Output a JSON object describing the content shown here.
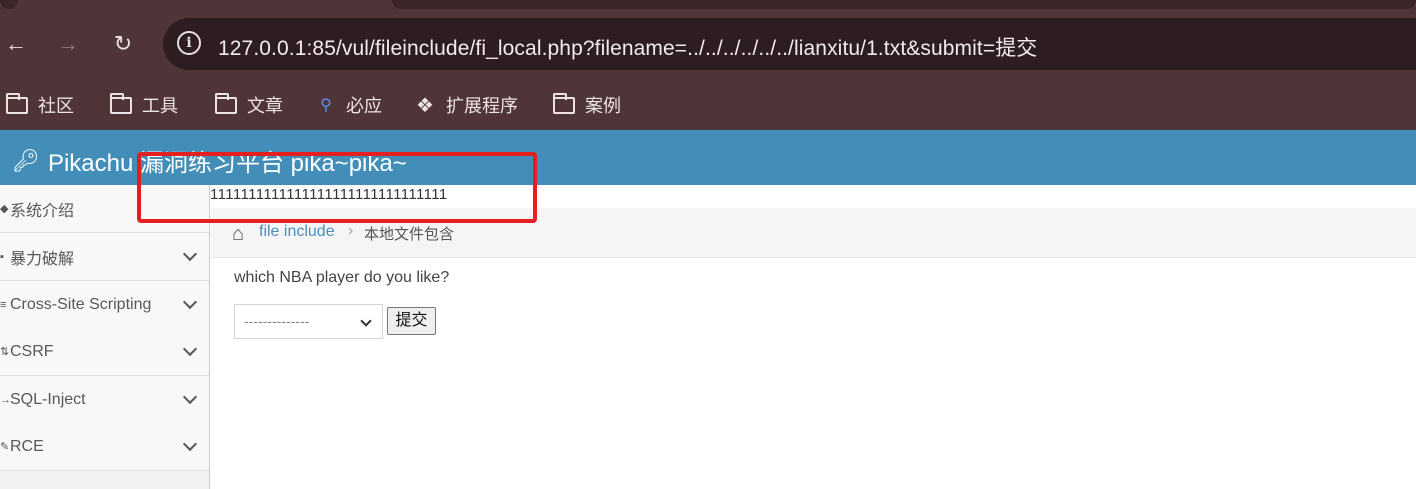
{
  "browser": {
    "back_icon": "back-arrow-icon",
    "forward_icon": "forward-arrow-icon",
    "reload_icon": "reload-icon",
    "url": "127.0.0.1:85/vul/fileinclude/fi_local.php?filename=../../../../../../lianxitu/1.txt&submit=提交",
    "bookmarks": [
      {
        "label": "社区",
        "icon": "folder-icon"
      },
      {
        "label": "工具",
        "icon": "folder-icon"
      },
      {
        "label": "文章",
        "icon": "folder-icon"
      },
      {
        "label": "必应",
        "icon": "search-icon"
      },
      {
        "label": "扩展程序",
        "icon": "puzzle-icon"
      },
      {
        "label": "案例",
        "icon": "folder-icon"
      }
    ]
  },
  "header": {
    "title": "Pikachu 漏洞练习平台 pika~pika~"
  },
  "included_content": "1111111111111111111111111111111",
  "sidebar": {
    "items": [
      {
        "label": "系统介绍"
      },
      {
        "label": "暴力破解"
      },
      {
        "label": "Cross-Site Scripting"
      },
      {
        "label": "CSRF"
      },
      {
        "label": "SQL-Inject"
      },
      {
        "label": "RCE"
      }
    ]
  },
  "breadcrumb": {
    "link": "file include",
    "current": "本地文件包含"
  },
  "form": {
    "question": "which NBA player do you like?",
    "select_value": "--------------",
    "submit_label": "提交"
  },
  "colors": {
    "browser_chrome": "#4f3438",
    "header": "#438eb9",
    "highlight": "#e31f1f",
    "link": "#4c8fbd"
  }
}
